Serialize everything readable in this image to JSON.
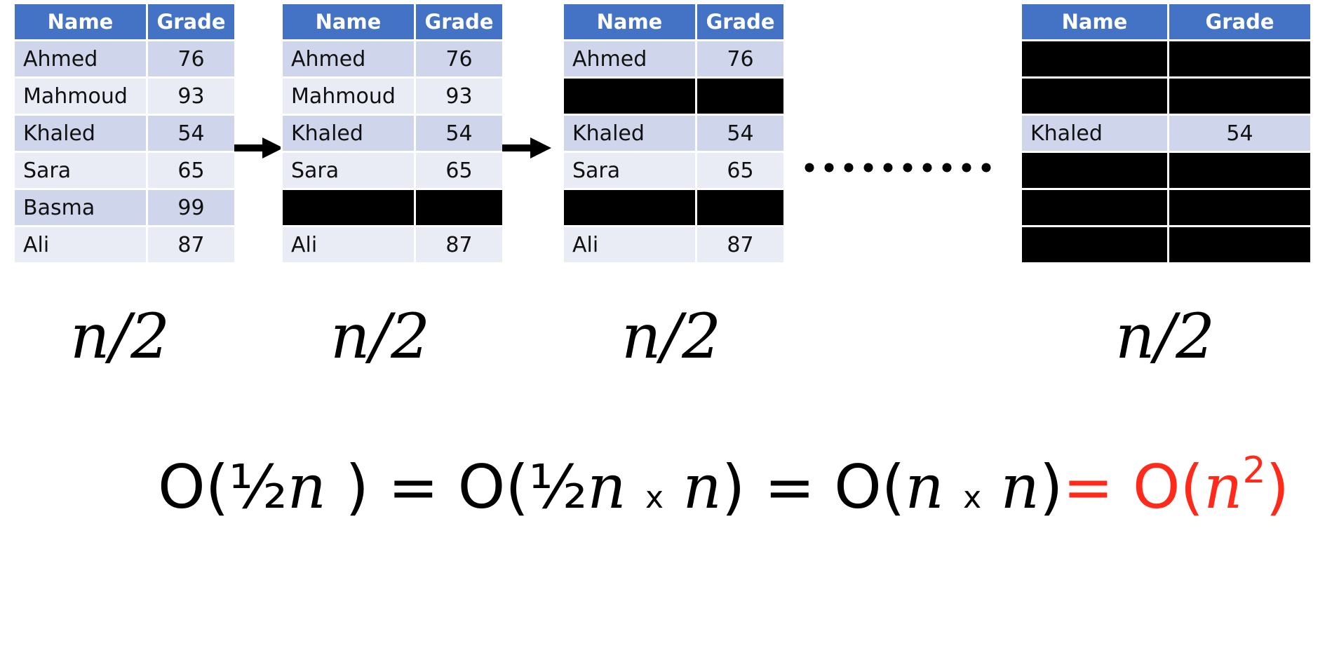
{
  "header": {
    "name": "Name",
    "grade": "Grade"
  },
  "tables": [
    {
      "rows": [
        {
          "name": "Ahmed",
          "grade": "76"
        },
        {
          "name": "Mahmoud",
          "grade": "93"
        },
        {
          "name": "Khaled",
          "grade": "54"
        },
        {
          "name": "Sara",
          "grade": "65"
        },
        {
          "name": "Basma",
          "grade": "99"
        },
        {
          "name": "Ali",
          "grade": "87"
        }
      ]
    },
    {
      "rows": [
        {
          "name": "Ahmed",
          "grade": "76"
        },
        {
          "name": "Mahmoud",
          "grade": "93"
        },
        {
          "name": "Khaled",
          "grade": "54"
        },
        {
          "name": "Sara",
          "grade": "65"
        },
        {
          "name": "",
          "grade": "",
          "hidden": true
        },
        {
          "name": "Ali",
          "grade": "87"
        }
      ]
    },
    {
      "rows": [
        {
          "name": "Ahmed",
          "grade": "76"
        },
        {
          "name": "",
          "grade": "",
          "hidden": true
        },
        {
          "name": "Khaled",
          "grade": "54"
        },
        {
          "name": "Sara",
          "grade": "65"
        },
        {
          "name": "",
          "grade": "",
          "hidden": true
        },
        {
          "name": "Ali",
          "grade": "87"
        }
      ]
    },
    {
      "rows": [
        {
          "name": "",
          "grade": "",
          "hidden": true
        },
        {
          "name": "",
          "grade": "",
          "hidden": true
        },
        {
          "name": "Khaled",
          "grade": "54"
        },
        {
          "name": "",
          "grade": "",
          "hidden": true
        },
        {
          "name": "",
          "grade": "",
          "hidden": true
        },
        {
          "name": "",
          "grade": "",
          "hidden": true
        }
      ]
    }
  ],
  "labels": [
    "n/2",
    "n/2",
    "n/2",
    "n/2"
  ],
  "formula": {
    "o": "O(",
    "half": "½",
    "n": "n",
    "close": ")",
    "eq": "=",
    "times": "x",
    "red_part": "= O(",
    "exp": "2"
  },
  "colors": {
    "header": "#4472c4",
    "row_odd": "#cfd5ea",
    "row_even": "#e9ebf5",
    "hidden_row": "#000000",
    "highlight": "#ff2a1a"
  },
  "icons": [
    "right-arrow-icon",
    "ellipsis-dots-icon"
  ]
}
